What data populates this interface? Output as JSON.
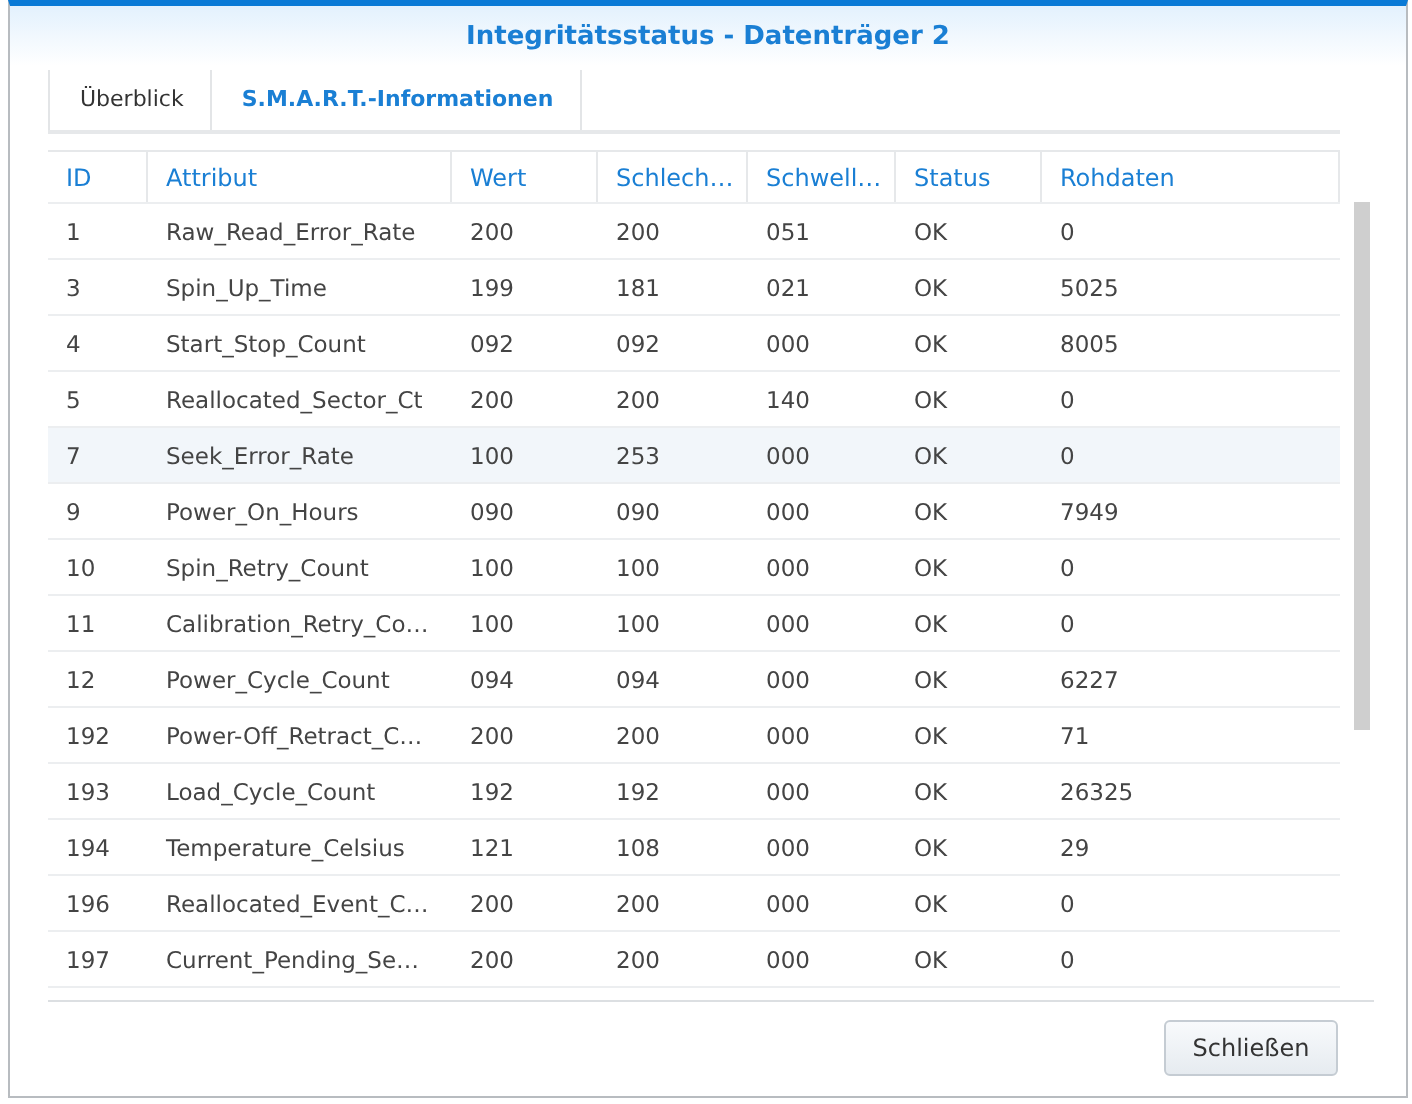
{
  "window": {
    "title": "Integritätsstatus - Datenträger 2"
  },
  "tabs": [
    {
      "label": "Überblick",
      "selected": false
    },
    {
      "label": "S.M.A.R.T.-Informationen",
      "selected": true
    }
  ],
  "table": {
    "columns": [
      "ID",
      "Attribut",
      "Wert",
      "Schlech…",
      "Schwell…",
      "Status",
      "Rohdaten"
    ],
    "rows": [
      {
        "cells": [
          "1",
          "Raw_Read_Error_Rate",
          "200",
          "200",
          "051",
          "OK",
          "0"
        ],
        "selected": false
      },
      {
        "cells": [
          "3",
          "Spin_Up_Time",
          "199",
          "181",
          "021",
          "OK",
          "5025"
        ],
        "selected": false
      },
      {
        "cells": [
          "4",
          "Start_Stop_Count",
          "092",
          "092",
          "000",
          "OK",
          "8005"
        ],
        "selected": false
      },
      {
        "cells": [
          "5",
          "Reallocated_Sector_Ct",
          "200",
          "200",
          "140",
          "OK",
          "0"
        ],
        "selected": false
      },
      {
        "cells": [
          "7",
          "Seek_Error_Rate",
          "100",
          "253",
          "000",
          "OK",
          "0"
        ],
        "selected": true
      },
      {
        "cells": [
          "9",
          "Power_On_Hours",
          "090",
          "090",
          "000",
          "OK",
          "7949"
        ],
        "selected": false
      },
      {
        "cells": [
          "10",
          "Spin_Retry_Count",
          "100",
          "100",
          "000",
          "OK",
          "0"
        ],
        "selected": false
      },
      {
        "cells": [
          "11",
          "Calibration_Retry_Co…",
          "100",
          "100",
          "000",
          "OK",
          "0"
        ],
        "selected": false
      },
      {
        "cells": [
          "12",
          "Power_Cycle_Count",
          "094",
          "094",
          "000",
          "OK",
          "6227"
        ],
        "selected": false
      },
      {
        "cells": [
          "192",
          "Power-Off_Retract_C…",
          "200",
          "200",
          "000",
          "OK",
          "71"
        ],
        "selected": false
      },
      {
        "cells": [
          "193",
          "Load_Cycle_Count",
          "192",
          "192",
          "000",
          "OK",
          "26325"
        ],
        "selected": false
      },
      {
        "cells": [
          "194",
          "Temperature_Celsius",
          "121",
          "108",
          "000",
          "OK",
          "29"
        ],
        "selected": false
      },
      {
        "cells": [
          "196",
          "Reallocated_Event_C…",
          "200",
          "200",
          "000",
          "OK",
          "0"
        ],
        "selected": false
      },
      {
        "cells": [
          "197",
          "Current_Pending_Se…",
          "200",
          "200",
          "000",
          "OK",
          "0"
        ],
        "selected": false
      }
    ]
  },
  "buttons": [
    "Schließen"
  ]
}
